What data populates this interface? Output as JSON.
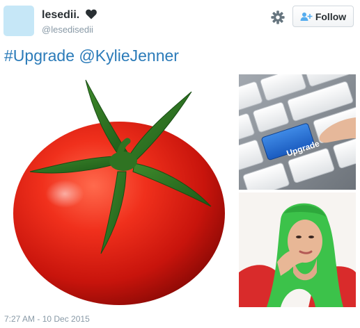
{
  "user": {
    "display_name": "lesedii.",
    "handle": "@lesedisedii"
  },
  "actions": {
    "settings_icon": "gear-icon",
    "follow_icon": "add-user-icon",
    "follow_label": "Follow"
  },
  "tweet": {
    "hashtag": "#Upgrade",
    "mention": "@KylieJenner",
    "timestamp": "7:27 AM - 10 Dec 2015"
  },
  "media": {
    "keyboard_key_label": "Upgrade",
    "photos": [
      "tomato-photo",
      "upgrade-keyboard-photo",
      "green-hair-person-photo"
    ]
  },
  "colors": {
    "link": "#2b7bb9",
    "muted": "#8899a6",
    "text": "#292f33"
  }
}
